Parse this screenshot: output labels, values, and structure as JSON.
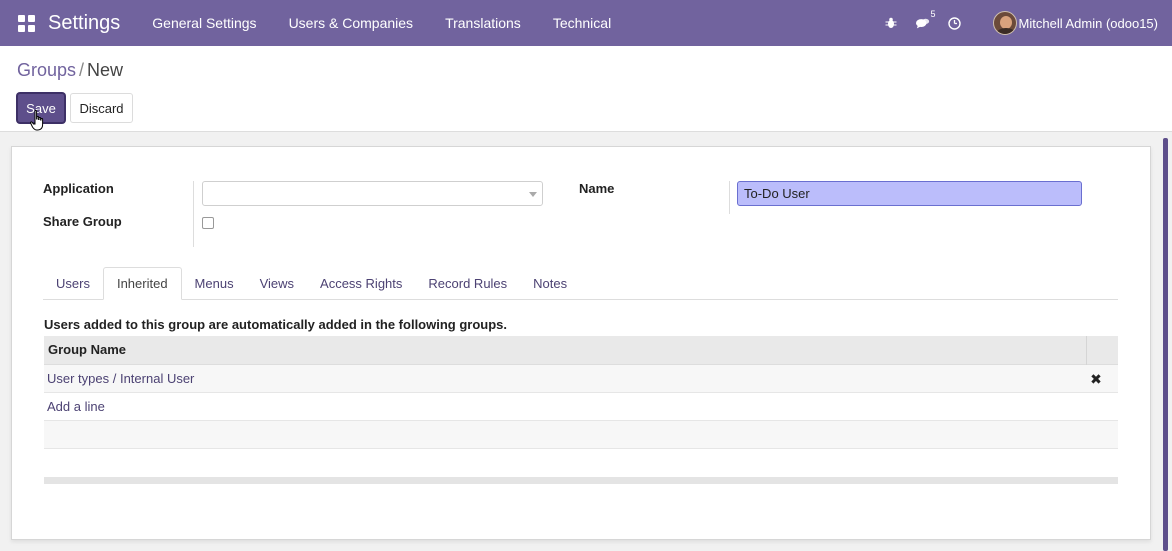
{
  "navbar": {
    "brand": "Settings",
    "menu": [
      "General Settings",
      "Users & Companies",
      "Translations",
      "Technical"
    ],
    "message_count": "5",
    "user_name": "Mitchell Admin (odoo15)",
    "icons": [
      "apps-icon",
      "bug-icon",
      "chat-icon",
      "clock-icon"
    ]
  },
  "breadcrumb": {
    "parent": "Groups",
    "current": "New"
  },
  "buttons": {
    "save": "Save",
    "discard": "Discard"
  },
  "form": {
    "application_label": "Application",
    "application_value": "",
    "share_group_label": "Share Group",
    "share_group_checked": false,
    "name_label": "Name",
    "name_value": "To-Do User"
  },
  "tabs": [
    {
      "label": "Users",
      "active": false
    },
    {
      "label": "Inherited",
      "active": true
    },
    {
      "label": "Menus",
      "active": false
    },
    {
      "label": "Views",
      "active": false
    },
    {
      "label": "Access Rights",
      "active": false
    },
    {
      "label": "Record Rules",
      "active": false
    },
    {
      "label": "Notes",
      "active": false
    }
  ],
  "inherited": {
    "info": "Users added to this group are automatically added in the following groups.",
    "column_header": "Group Name",
    "rows": [
      "User types / Internal User"
    ],
    "add_line": "Add a line"
  },
  "colors": {
    "navbar": "#71639e",
    "primary": "#5e4f8b",
    "link": "#4c4273",
    "name_input_bg": "#bbbdfb"
  }
}
